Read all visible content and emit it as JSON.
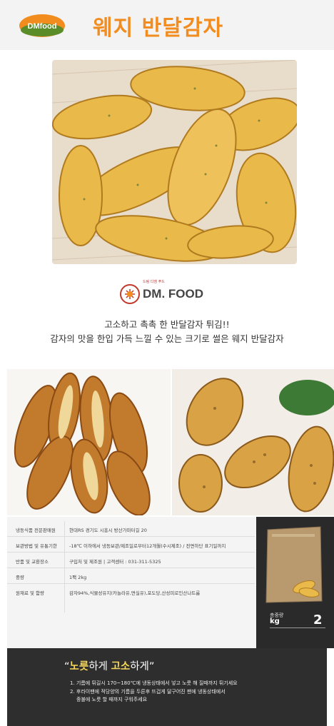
{
  "header": {
    "logo_text": "DMfood",
    "title": "웨지 반달감자"
  },
  "brand": {
    "name": "DM. FOOD",
    "small_text": "드림 디엠 푸드"
  },
  "tagline": {
    "line1": "고소하고 촉촉 한 반달감자 튀김!!",
    "line2": "감자의 맛을  한입 가득 느낄 수 있는 크기로 썰은 웨지 반달감자"
  },
  "info": {
    "rows": [
      {
        "key": "냉동식품 전문판매원",
        "value": "현대RS   경기도 시흥시 방산가마터길 20"
      },
      {
        "key": "보관방법 및 유통기한",
        "value": "-18℃ 이하에서 냉동보관/제조일로부터12개월(수시제조) / 전면하단 표기일까지"
      },
      {
        "key": "반품 및 교환장소",
        "value": "구입처 및 제조원  |  고객센터 : 031-311-5325"
      },
      {
        "key": "중량",
        "value": "1팩 2kg"
      },
      {
        "key": "원재료 및 함량",
        "value": "감자94%,식물성유지(카놀라유,면실유),포도당,산성피로인산나트륨"
      }
    ],
    "package": {
      "label": "총중량",
      "unit": "kg",
      "number": "2"
    }
  },
  "cooking": {
    "quote_open": "“",
    "quote_word1": "노릇",
    "quote_mid": "하게 ",
    "quote_word2": "고소",
    "quote_end": "하게”",
    "step1": "1. 기름에 튀길시 170~180℃에 냉동상태에서  넣고 노릇 해 질때까지 튀기세요",
    "step2": "2. 후라이팬에 적당양의 기름을 두른후 뜨겁게 달구어진 팬에 냉동상태에서",
    "step2b": "중불에 노릇 할 때까지 구워주세요"
  },
  "colors": {
    "title": "#f28c1f",
    "accent": "#f5d65a",
    "dark_panel": "#2e2e2e"
  }
}
